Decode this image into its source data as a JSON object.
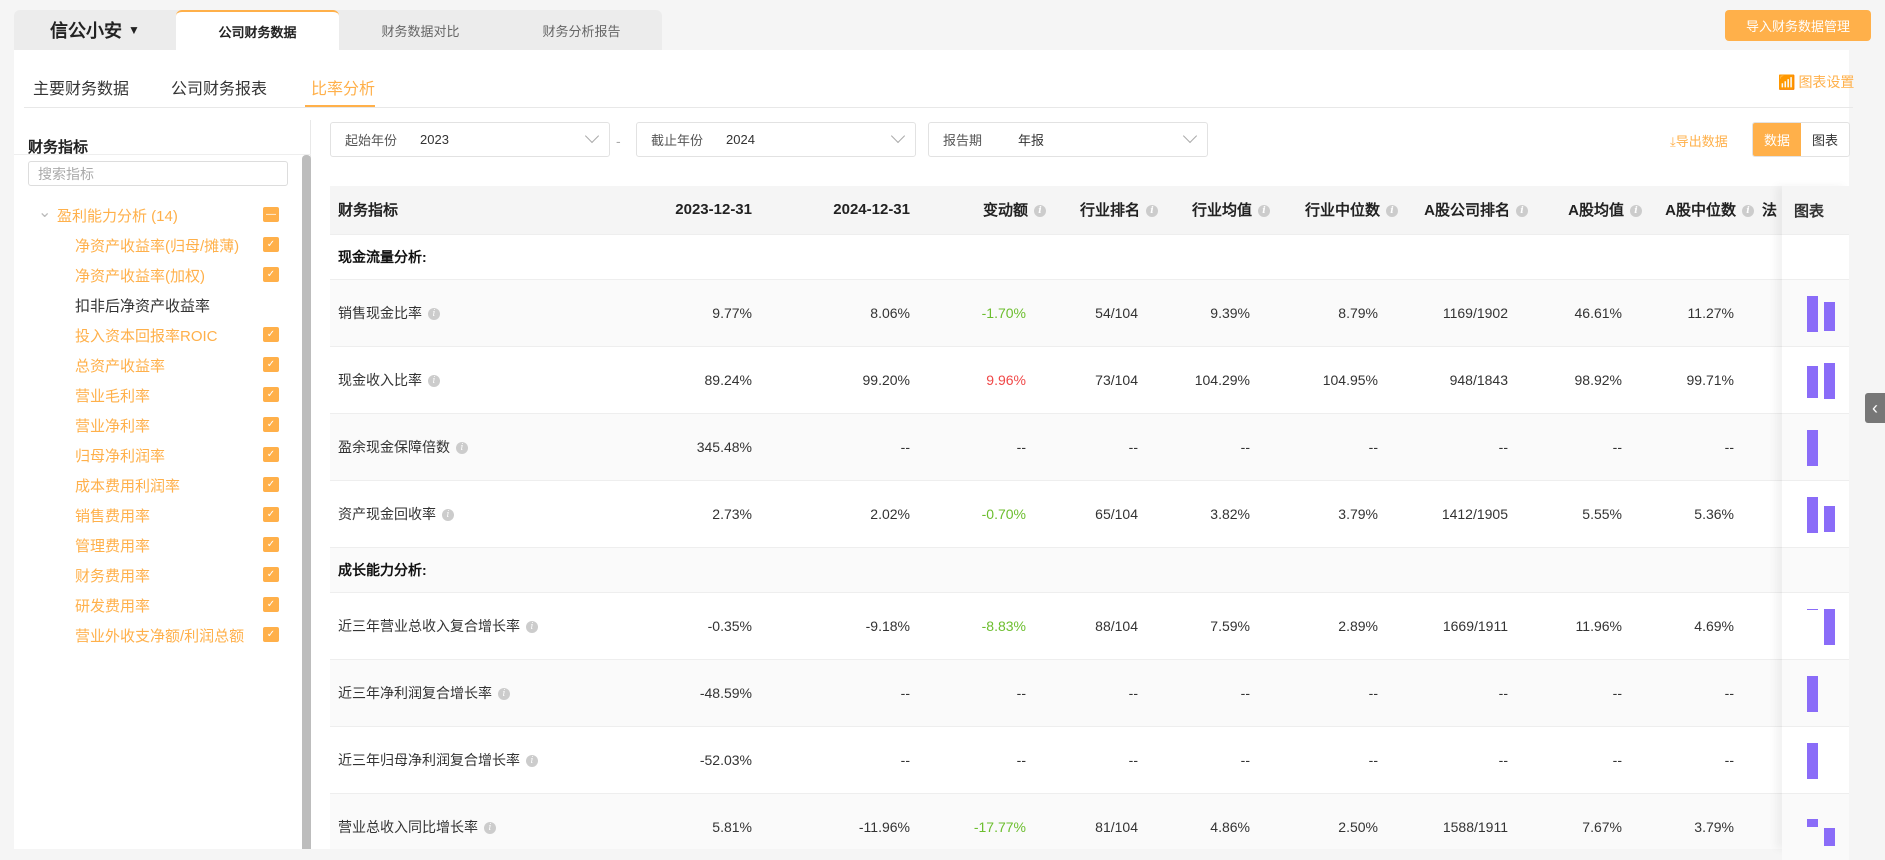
{
  "brand": {
    "name": "信公小安"
  },
  "top_tabs": [
    "公司财务数据",
    "财务数据对比",
    "财务分析报告"
  ],
  "import_button": "导入财务数据管理",
  "sub_tabs": [
    "主要财务数据",
    "公司财务报表",
    "比率分析"
  ],
  "chart_settings": "图表设置",
  "sidebar": {
    "title": "财务指标",
    "search_placeholder": "搜索指标",
    "group": {
      "label": "盈利能力分析 (14)",
      "state": "partial"
    },
    "items": [
      {
        "label": "净资产收益率(归母/摊薄)",
        "checked": true
      },
      {
        "label": "净资产收益率(加权)",
        "checked": true
      },
      {
        "label": "扣非后净资产收益率",
        "checked": false
      },
      {
        "label": "投入资本回报率ROIC",
        "checked": true
      },
      {
        "label": "总资产收益率",
        "checked": true
      },
      {
        "label": "营业毛利率",
        "checked": true
      },
      {
        "label": "营业净利率",
        "checked": true
      },
      {
        "label": "归母净利润率",
        "checked": true
      },
      {
        "label": "成本费用利润率",
        "checked": true
      },
      {
        "label": "销售费用率",
        "checked": true
      },
      {
        "label": "管理费用率",
        "checked": true
      },
      {
        "label": "财务费用率",
        "checked": true
      },
      {
        "label": "研发费用率",
        "checked": true
      },
      {
        "label": "营业外收支净额/利润总额",
        "checked": true
      }
    ]
  },
  "filters": {
    "start": {
      "label": "起始年份",
      "value": "2023"
    },
    "end": {
      "label": "截止年份",
      "value": "2024"
    },
    "period": {
      "label": "报告期",
      "value": "年报"
    },
    "separator": "-"
  },
  "export": "导出数据",
  "view_toggle": {
    "data": "数据",
    "chart": "图表",
    "active": "data"
  },
  "table": {
    "headers": [
      "财务指标",
      "2023-12-31",
      "2024-12-31",
      "变动额",
      "行业排名",
      "行业均值",
      "行业中位数",
      "A股公司排名",
      "A股均值",
      "A股中位数",
      "法"
    ],
    "info_cols": [
      0,
      0,
      0,
      1,
      1,
      1,
      1,
      1,
      1,
      1,
      0
    ],
    "chart_header": "图表",
    "rows": [
      {
        "section": "现金流量分析:"
      },
      {
        "name": "销售现金比率",
        "v": [
          "9.77%",
          "8.06%",
          "-1.70%",
          "54/104",
          "9.39%",
          "8.79%",
          "1169/1902",
          "46.61%",
          "11.27%"
        ],
        "trend": "neg",
        "bars": [
          9.77,
          8.06
        ]
      },
      {
        "name": "现金收入比率",
        "v": [
          "89.24%",
          "99.20%",
          "9.96%",
          "73/104",
          "104.29%",
          "104.95%",
          "948/1843",
          "98.92%",
          "99.71%"
        ],
        "trend": "pos",
        "bars": [
          89.24,
          99.2
        ]
      },
      {
        "name": "盈余现金保障倍数",
        "v": [
          "345.48%",
          "--",
          "--",
          "--",
          "--",
          "--",
          "--",
          "--",
          "--"
        ],
        "trend": "",
        "bars": [
          345.48,
          null
        ]
      },
      {
        "name": "资产现金回收率",
        "v": [
          "2.73%",
          "2.02%",
          "-0.70%",
          "65/104",
          "3.82%",
          "3.79%",
          "1412/1905",
          "5.55%",
          "5.36%"
        ],
        "trend": "neg",
        "bars": [
          2.73,
          2.02
        ]
      },
      {
        "section": "成长能力分析:"
      },
      {
        "name": "近三年营业总收入复合增长率",
        "v": [
          "-0.35%",
          "-9.18%",
          "-8.83%",
          "88/104",
          "7.59%",
          "2.89%",
          "1669/1911",
          "11.96%",
          "4.69%"
        ],
        "trend": "neg",
        "bars": [
          -0.35,
          -9.18
        ]
      },
      {
        "name": "近三年净利润复合增长率",
        "v": [
          "-48.59%",
          "--",
          "--",
          "--",
          "--",
          "--",
          "--",
          "--",
          "--"
        ],
        "trend": "",
        "bars": [
          -48.59,
          null
        ]
      },
      {
        "name": "近三年归母净利润复合增长率",
        "v": [
          "-52.03%",
          "--",
          "--",
          "--",
          "--",
          "--",
          "--",
          "--",
          "--"
        ],
        "trend": "",
        "bars": [
          -52.03,
          null
        ]
      },
      {
        "name": "营业总收入同比增长率",
        "v": [
          "5.81%",
          "-11.96%",
          "-17.77%",
          "81/104",
          "4.86%",
          "2.50%",
          "1588/1911",
          "7.67%",
          "3.79%"
        ],
        "trend": "neg",
        "bars": [
          5.81,
          -11.96
        ]
      }
    ]
  },
  "colors": {
    "accent": "#ffb04a",
    "bar": "#8a6cf8",
    "up": "#f04848",
    "down": "#6cbe2e"
  }
}
